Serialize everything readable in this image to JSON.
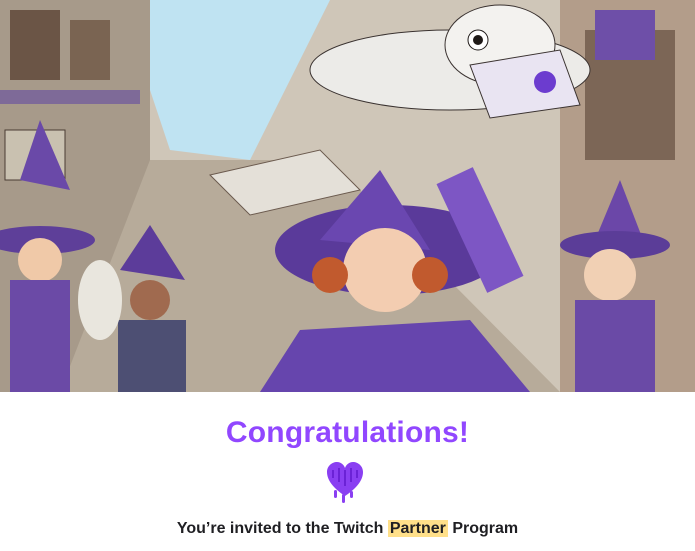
{
  "hero": {
    "image_icon": "witch-academy-owl-illustration"
  },
  "heading": "Congratulations!",
  "heart_icon": "purple-dripping-heart-icon",
  "invite": {
    "prefix": "You’re invited to the Twitch ",
    "highlight": "Partner",
    "suffix": " Program"
  },
  "colors": {
    "accent": "#9147ff",
    "highlight": "#ffe08a",
    "text": "#1f1f23"
  }
}
